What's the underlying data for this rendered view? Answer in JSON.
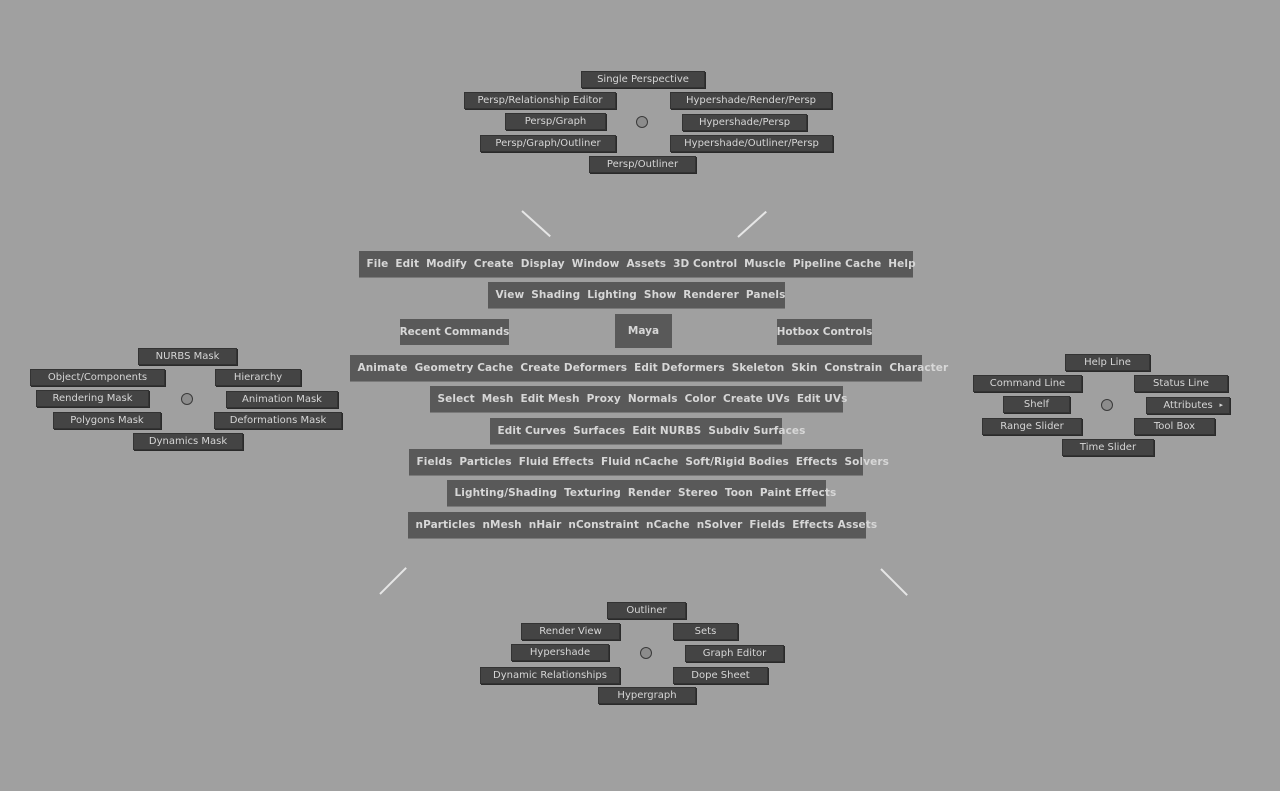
{
  "north_menu": {
    "items": [
      "Single Perspective",
      "Persp/Relationship Editor",
      "Hypershade/Render/Persp",
      "Persp/Graph",
      "Hypershade/Persp",
      "Persp/Graph/Outliner",
      "Hypershade/Outliner/Persp",
      "Persp/Outliner"
    ]
  },
  "west_menu": {
    "items": [
      "NURBS Mask",
      "Object/Components",
      "Hierarchy",
      "Rendering Mask",
      "Animation Mask",
      "Polygons Mask",
      "Deformations Mask",
      "Dynamics Mask"
    ]
  },
  "east_menu": {
    "items": [
      "Help Line",
      "Command Line",
      "Status Line",
      "Shelf",
      "Attributes",
      "Range Slider",
      "Tool Box",
      "Time Slider"
    ],
    "submenu_arrow": "▸"
  },
  "south_menu": {
    "items": [
      "Outliner",
      "Render View",
      "Sets",
      "Hypershade",
      "Graph Editor",
      "Dynamic Relationships",
      "Dope Sheet",
      "Hypergraph"
    ]
  },
  "hotbox": {
    "rows": [
      [
        "File",
        "Edit",
        "Modify",
        "Create",
        "Display",
        "Window",
        "Assets",
        "3D Control",
        "Muscle",
        "Pipeline Cache",
        "Help"
      ],
      [
        "View",
        "Shading",
        "Lighting",
        "Show",
        "Renderer",
        "Panels"
      ],
      [
        "Animate",
        "Geometry Cache",
        "Create Deformers",
        "Edit Deformers",
        "Skeleton",
        "Skin",
        "Constrain",
        "Character"
      ],
      [
        "Select",
        "Mesh",
        "Edit Mesh",
        "Proxy",
        "Normals",
        "Color",
        "Create UVs",
        "Edit UVs"
      ],
      [
        "Edit Curves",
        "Surfaces",
        "Edit NURBS",
        "Subdiv Surfaces"
      ],
      [
        "Fields",
        "Particles",
        "Fluid Effects",
        "Fluid nCache",
        "Soft/Rigid Bodies",
        "Effects",
        "Solvers"
      ],
      [
        "Lighting/Shading",
        "Texturing",
        "Render",
        "Stereo",
        "Toon",
        "Paint Effects"
      ],
      [
        "nParticles",
        "nMesh",
        "nHair",
        "nConstraint",
        "nCache",
        "nSolver",
        "Fields",
        "Effects Assets"
      ]
    ],
    "recent_commands": "Recent Commands",
    "center": "Maya",
    "hotbox_controls": "Hotbox Controls"
  }
}
